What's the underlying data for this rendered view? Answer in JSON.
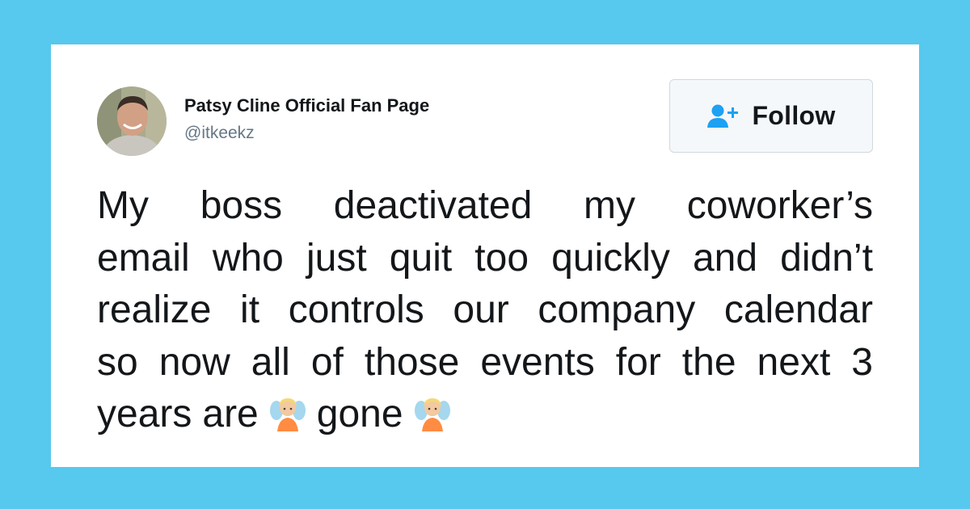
{
  "tweet": {
    "author": {
      "display_name": "Patsy Cline Official Fan Page",
      "handle": "@itkeekz"
    },
    "follow_button": {
      "label": "Follow",
      "icon": "add-user-icon"
    },
    "text_lines": [
      [
        "My",
        "boss",
        "deactivated",
        "my",
        "coworker’s"
      ],
      [
        "email",
        "who",
        "just",
        "quit",
        "too",
        "quickly",
        "and",
        "didn’t"
      ],
      [
        "realize",
        "it",
        "controls",
        "our",
        "company",
        "calendar"
      ],
      [
        "so",
        "now",
        "all",
        "of",
        "those",
        "events",
        "for",
        "the",
        "next",
        "3"
      ]
    ],
    "last_line": {
      "word1": "years",
      "word2": "are",
      "word3": "gone",
      "emoji": "man-fairy-emoji"
    }
  },
  "colors": {
    "background": "#57c8ee",
    "card": "#ffffff",
    "text": "#14171a",
    "handle": "#657786",
    "accent": "#1da1f2"
  }
}
